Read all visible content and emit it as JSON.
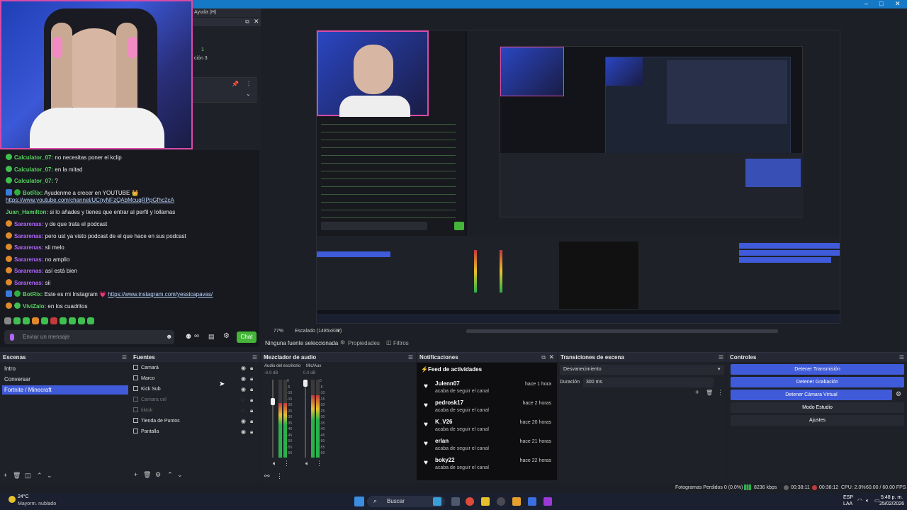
{
  "window": {
    "menu_remnant": "Ayuda (H)",
    "controls": [
      "–",
      "□",
      "✕"
    ]
  },
  "left_overlay": {
    "partial_labels": [
      "1",
      "ción 3"
    ]
  },
  "chat": {
    "messages": [
      {
        "user": "Calculator_07:",
        "text": " no necesitas poner el kclip",
        "user_color": "#56d35e",
        "icon_color": "#3fbf4f"
      },
      {
        "user": "Calculator_07:",
        "text": " en la mitad",
        "user_color": "#56d35e",
        "icon_color": "#3fbf4f"
      },
      {
        "user": "Calculator_07:",
        "text": " ?",
        "user_color": "#56d35e",
        "icon_color": "#3fbf4f"
      },
      {
        "user": "BotRix:",
        "text": " Ayudenme a crecer en YOUTUBE 👑",
        "user_color": "#56d35e",
        "icon_color": "#3b7be0",
        "badge": true
      },
      {
        "user": "",
        "link": "https://www.youtube.com/channel/UCnyNFzQAbMcuqRPpGfhc2cA",
        "user_color": "#56d35e"
      },
      {
        "user": "Juan_Hamilton:",
        "text": " si lo añades y tienes que entrar al perfil y lollamas",
        "user_color": "#56d35e"
      },
      {
        "user": "Sararenas:",
        "text": " y de que trata el podcast",
        "user_color": "#b366ff",
        "icon_color": "#e0892b"
      },
      {
        "user": "Sararenas:",
        "text": " pero ust ya visto podcast de el que hace en sus podcast",
        "user_color": "#b366ff",
        "icon_color": "#e0892b"
      },
      {
        "user": "Sararenas:",
        "text": " sii melo",
        "user_color": "#b366ff",
        "icon_color": "#e0892b"
      },
      {
        "user": "Sararenas:",
        "text": " no amplio",
        "user_color": "#b366ff",
        "icon_color": "#e0892b"
      },
      {
        "user": "Sararenas:",
        "text": " así está bien",
        "user_color": "#b366ff",
        "icon_color": "#e0892b"
      },
      {
        "user": "Sararenas:",
        "text": " sii",
        "user_color": "#b366ff",
        "icon_color": "#e0892b"
      },
      {
        "user": "BotRix:",
        "text": " Este es mi Instagram 💗 ",
        "link": "https://www.instagram.com/yessicapavas/",
        "user_color": "#56d35e",
        "icon_color": "#3b7be0",
        "badge": true
      },
      {
        "user": "ViviZalo:",
        "text": " en los cuadritos",
        "user_color": "#56d35e",
        "icon_color": "#e0892b"
      }
    ],
    "input_placeholder": "Enviar un mensaje",
    "send_label": "Chat"
  },
  "preview": {
    "zoom": "77%",
    "scale_label": "Escalado (1485x832)"
  },
  "source_toolbar": {
    "no_source": "Ninguna fuente seleccionada",
    "properties": "Propiedades",
    "filters": "Filtros"
  },
  "scenes": {
    "title": "Escenas",
    "items": [
      "Intro",
      "Conversar",
      "Fortnite / Minecraft"
    ],
    "selected_index": 2
  },
  "sources": {
    "title": "Fuentes",
    "items": [
      {
        "label": "Camará",
        "hidden": false
      },
      {
        "label": "Marco",
        "hidden": false
      },
      {
        "label": "Kick Sub",
        "hidden": false
      },
      {
        "label": "Camara cel",
        "hidden": true
      },
      {
        "label": "tiktok",
        "hidden": true
      },
      {
        "label": "Tienda de Puntos",
        "hidden": false
      },
      {
        "label": "Pantalla",
        "hidden": false
      }
    ]
  },
  "mixer": {
    "title": "Mezclador de audio",
    "channels": [
      {
        "name": "Audio del escritorio",
        "db": "-6.9 dB",
        "level": 0.7
      },
      {
        "name": "Mic/Aux",
        "db": "0.0 dB",
        "level": 0.8
      }
    ],
    "scale": [
      "0",
      "-5",
      "-10",
      "-15",
      "-20",
      "-25",
      "-30",
      "-35",
      "-40",
      "-45",
      "-50",
      "-55",
      "-60"
    ]
  },
  "notifications": {
    "title": "Notificaciones",
    "feed_title": "Feed de actividades",
    "items": [
      {
        "user": "Julenn07",
        "msg": "acaba de seguir el canal",
        "time": "hace 1 hora"
      },
      {
        "user": "pedrosk17",
        "msg": "acaba de seguir el canal",
        "time": "hace 2 horas"
      },
      {
        "user": "K_V26",
        "msg": "acaba de seguir el canal",
        "time": "hace 20 horas"
      },
      {
        "user": "erlan",
        "msg": "acaba de seguir el canal",
        "time": "hace 21 horas"
      },
      {
        "user": "boky22",
        "msg": "acaba de seguir el canal",
        "time": "hace 22 horas"
      }
    ]
  },
  "transitions": {
    "title": "Transiciones de escena",
    "selected": "Desvanecimiento",
    "duration_label": "Duración",
    "duration_value": "300 ms"
  },
  "controls": {
    "title": "Controles",
    "buttons": [
      {
        "label": "Detener Transmisión",
        "active": true
      },
      {
        "label": "Detener Grabación",
        "active": true
      },
      {
        "label": "Detener Cámara Virtual",
        "active": true
      },
      {
        "label": "Modo Estudio",
        "active": false
      },
      {
        "label": "Ajustes",
        "active": false
      }
    ]
  },
  "statusbar": {
    "dropped": "Fotogramas Perdidos 0 (0.0%)",
    "bitrate": "8236 kbps",
    "stream_time": "00:38:11",
    "rec_time": "00:38:12",
    "cpu": "CPU: 2.0%",
    "fps": "60.00 / 60.00 FPS"
  },
  "taskbar": {
    "weather_temp": "24°C",
    "weather_desc": "Mayorm. nublado",
    "search": "Buscar",
    "lang": "ESP",
    "lang2": "LAA",
    "time": "5:48 p. m.",
    "date": "25/02/2026"
  }
}
